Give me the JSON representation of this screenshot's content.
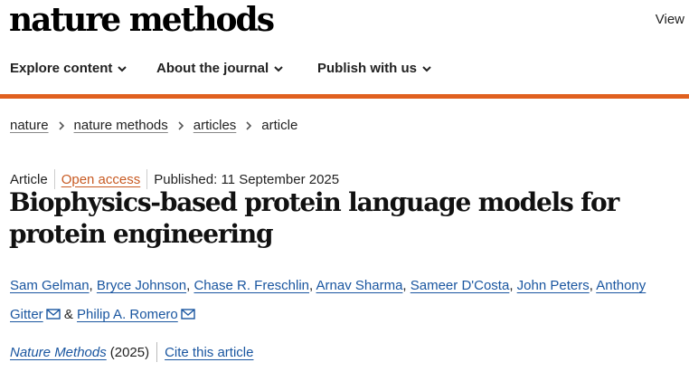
{
  "header": {
    "logo": "nature methods",
    "view_label": "View"
  },
  "nav": {
    "items": [
      {
        "label": "Explore content"
      },
      {
        "label": "About the journal"
      },
      {
        "label": "Publish with us"
      }
    ]
  },
  "colors": {
    "accent_bar": "#e0601f",
    "link": "#1a56a0",
    "open_access": "#c85a22"
  },
  "breadcrumb": {
    "items": [
      "nature",
      "nature methods",
      "articles",
      "article"
    ]
  },
  "article": {
    "type": "Article",
    "access": "Open access",
    "published": "Published: 11 September 2025",
    "title": "Biophysics-based protein language models for protein engineering",
    "authors": [
      "Sam Gelman",
      "Bryce Johnson",
      "Chase R. Freschlin",
      "Arnav Sharma",
      "Sameer D'Costa",
      "John Peters",
      "Anthony Gitter",
      "Philip A. Romero"
    ],
    "author_separator": ", ",
    "author_and": " & ",
    "journal": "Nature Methods",
    "year": "(2025)",
    "cite_label": "Cite this article"
  }
}
